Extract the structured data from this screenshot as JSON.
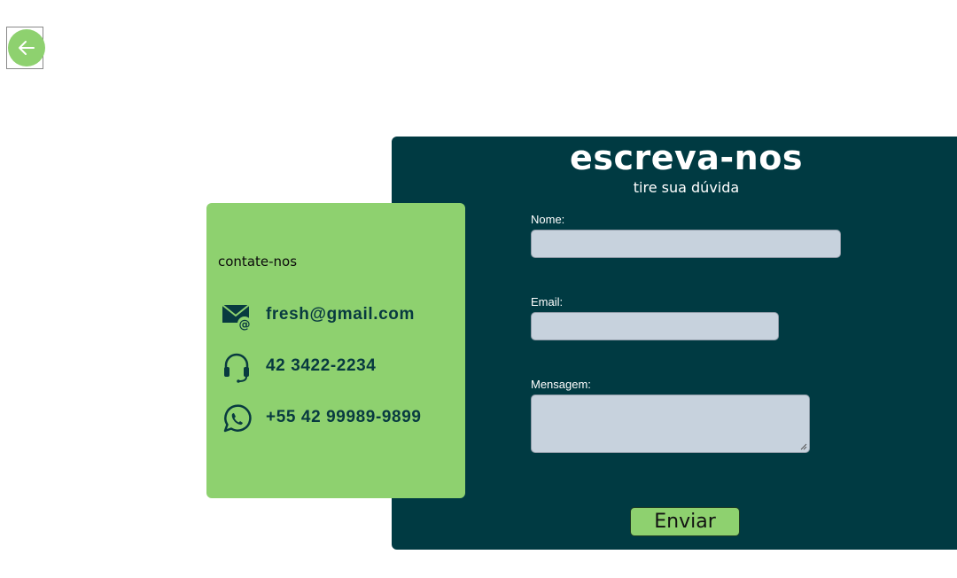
{
  "back_button": {
    "icon": "arrow-left-icon",
    "accent": "#8ed16f"
  },
  "contact_card": {
    "title": "contate-nos",
    "items": [
      {
        "icon": "mail-at-icon",
        "text": "fresh@gmail.com"
      },
      {
        "icon": "headset-icon",
        "text": "42 3422-2234"
      },
      {
        "icon": "whatsapp-icon",
        "text": "+55 42 99989-9899"
      }
    ],
    "background": "#8ed16f"
  },
  "form": {
    "title": "escreva-nos",
    "subtitle": "tire sua dúvida",
    "fields": [
      {
        "label": "Nome:",
        "value": ""
      },
      {
        "label": "Email:",
        "value": ""
      },
      {
        "label": "Mensagem:",
        "value": ""
      }
    ],
    "submit_label": "Enviar",
    "background": "#003a42",
    "field_color": "#c7d2dd"
  }
}
